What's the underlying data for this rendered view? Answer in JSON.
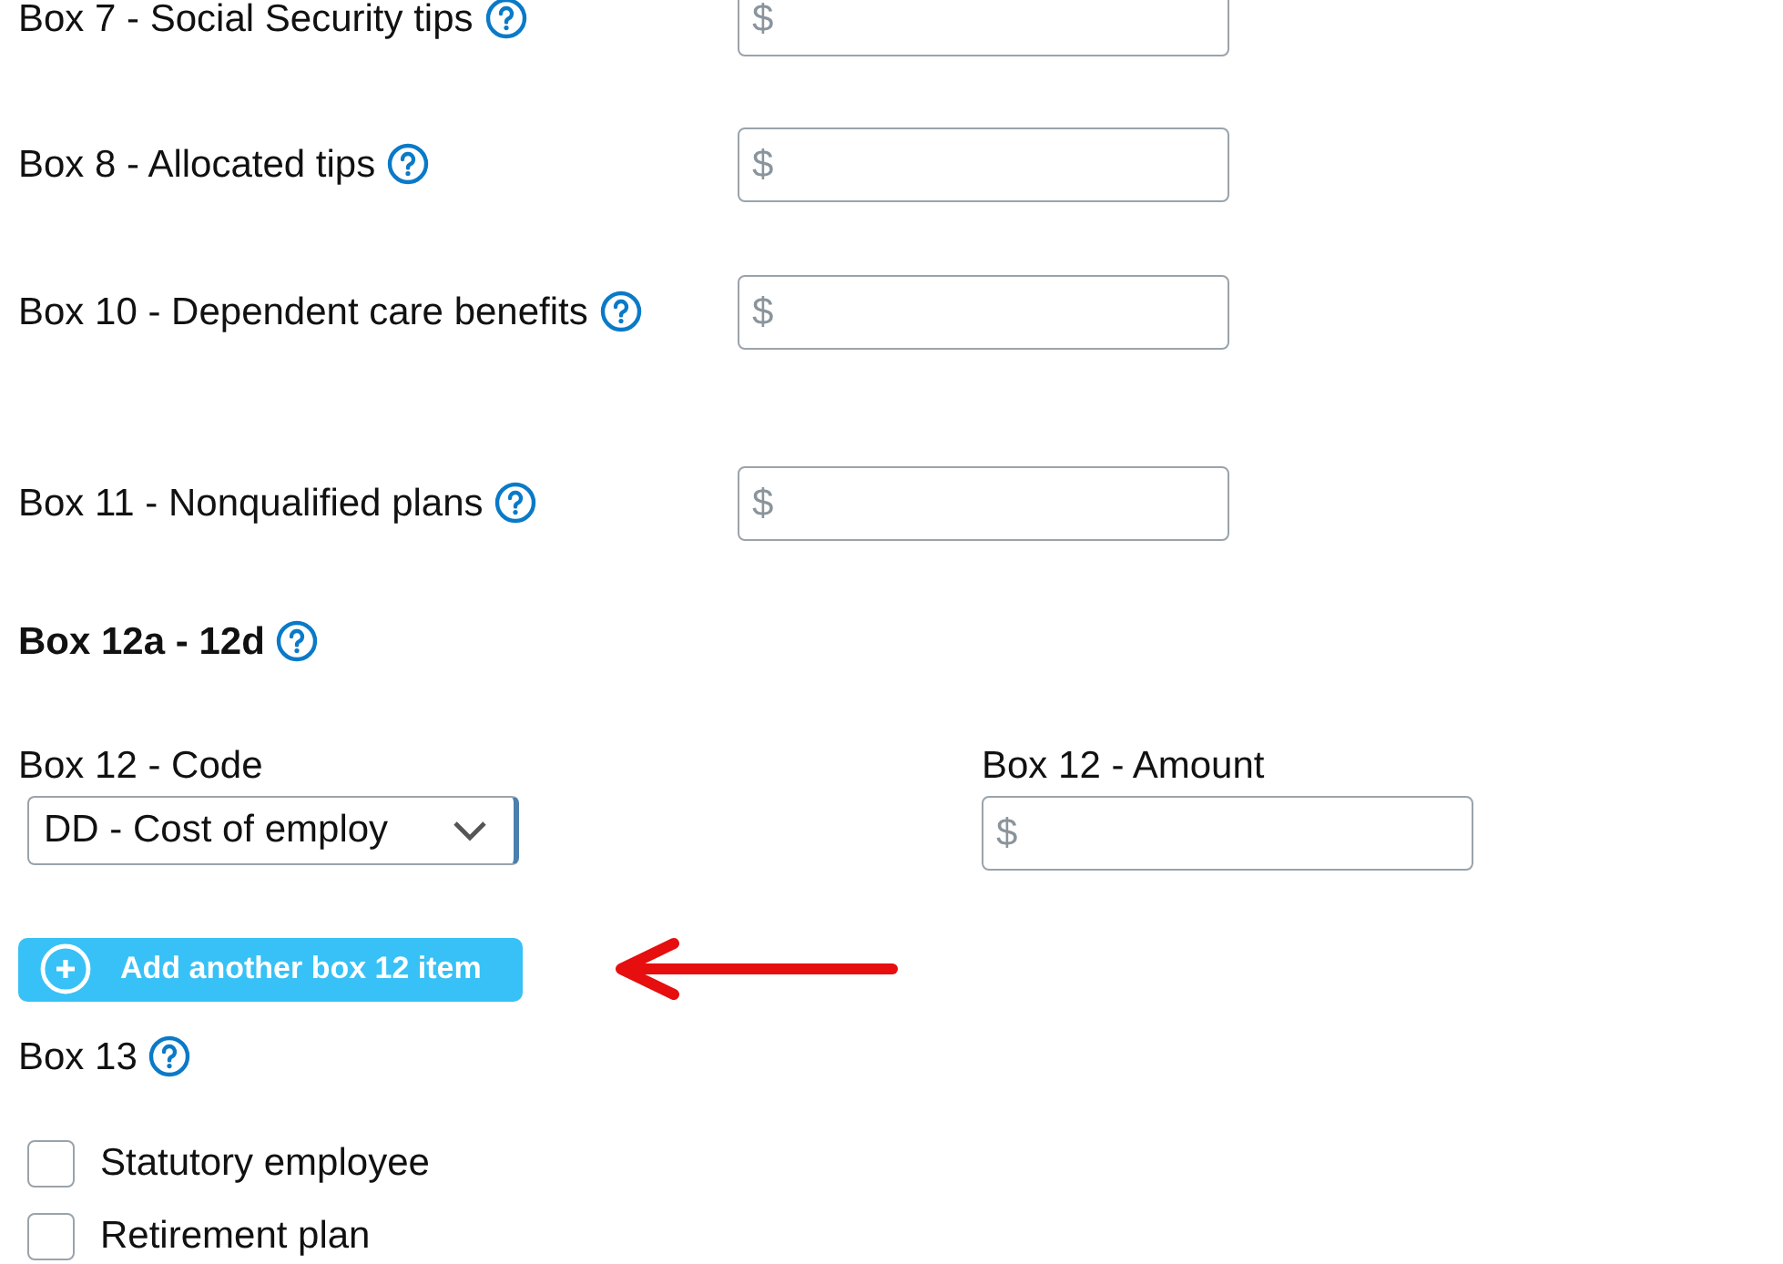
{
  "amount_fields": [
    {
      "label": "Box 7 - Social Security tips",
      "prefix": "$"
    },
    {
      "label": "Box 8 - Allocated tips",
      "prefix": "$"
    },
    {
      "label": "Box 10 - Dependent care benefits",
      "prefix": "$"
    },
    {
      "label": "Box 11 - Nonqualified plans",
      "prefix": "$"
    }
  ],
  "box12": {
    "heading": "Box 12a - 12d",
    "code_label": "Box 12 - Code",
    "code_value": "DD - Cost of employ",
    "amount_label": "Box 12 - Amount",
    "amount_prefix": "$",
    "add_button": "Add another box 12 item"
  },
  "box13": {
    "heading": "Box 13",
    "checkboxes": [
      {
        "label": "Statutory employee",
        "checked": false
      },
      {
        "label": "Retirement plan",
        "checked": false
      }
    ]
  }
}
